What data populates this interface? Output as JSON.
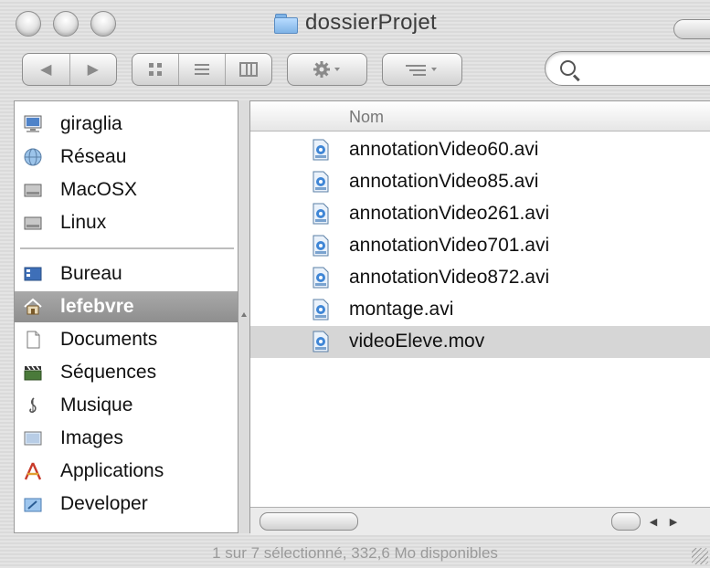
{
  "window": {
    "title": "dossierProjet"
  },
  "toolbar": {
    "nav_back_icon": "arrow-left",
    "nav_forward_icon": "arrow-right",
    "view_icons": [
      "grid-icon",
      "list-icon",
      "columns-icon"
    ],
    "action_icon": "gear-icon",
    "arrange_icon": "arrange-icon",
    "search_value": ""
  },
  "sidebar": {
    "devices": [
      {
        "label": "giraglia",
        "icon": "computer-icon"
      },
      {
        "label": "Réseau",
        "icon": "network-globe-icon"
      },
      {
        "label": "MacOSX",
        "icon": "hard-disk-icon"
      },
      {
        "label": "Linux",
        "icon": "hard-disk-icon"
      }
    ],
    "places": [
      {
        "label": "Bureau",
        "icon": "desktop-icon"
      },
      {
        "label": "lefebvre",
        "icon": "home-icon",
        "selected": true
      },
      {
        "label": "Documents",
        "icon": "document-icon"
      },
      {
        "label": "Séquences",
        "icon": "clapboard-icon"
      },
      {
        "label": "Musique",
        "icon": "music-note-icon"
      },
      {
        "label": "Images",
        "icon": "picture-icon"
      },
      {
        "label": "Applications",
        "icon": "applications-icon"
      },
      {
        "label": "Developer",
        "icon": "developer-folder-icon"
      }
    ]
  },
  "list": {
    "column_header": "Nom",
    "files": [
      {
        "name": "annotationVideo60.avi"
      },
      {
        "name": "annotationVideo85.avi"
      },
      {
        "name": "annotationVideo261.avi"
      },
      {
        "name": "annotationVideo701.avi"
      },
      {
        "name": "annotationVideo872.avi"
      },
      {
        "name": "montage.avi"
      },
      {
        "name": "videoEleve.mov",
        "selected": true
      }
    ]
  },
  "status": {
    "text": "1 sur 7 sélectionné, 332,6 Mo disponibles"
  },
  "colors": {
    "selection_gray": "#d6d6d6",
    "sidebar_selection": "#9a9a9a",
    "file_icon_blue": "#3f86d6"
  }
}
